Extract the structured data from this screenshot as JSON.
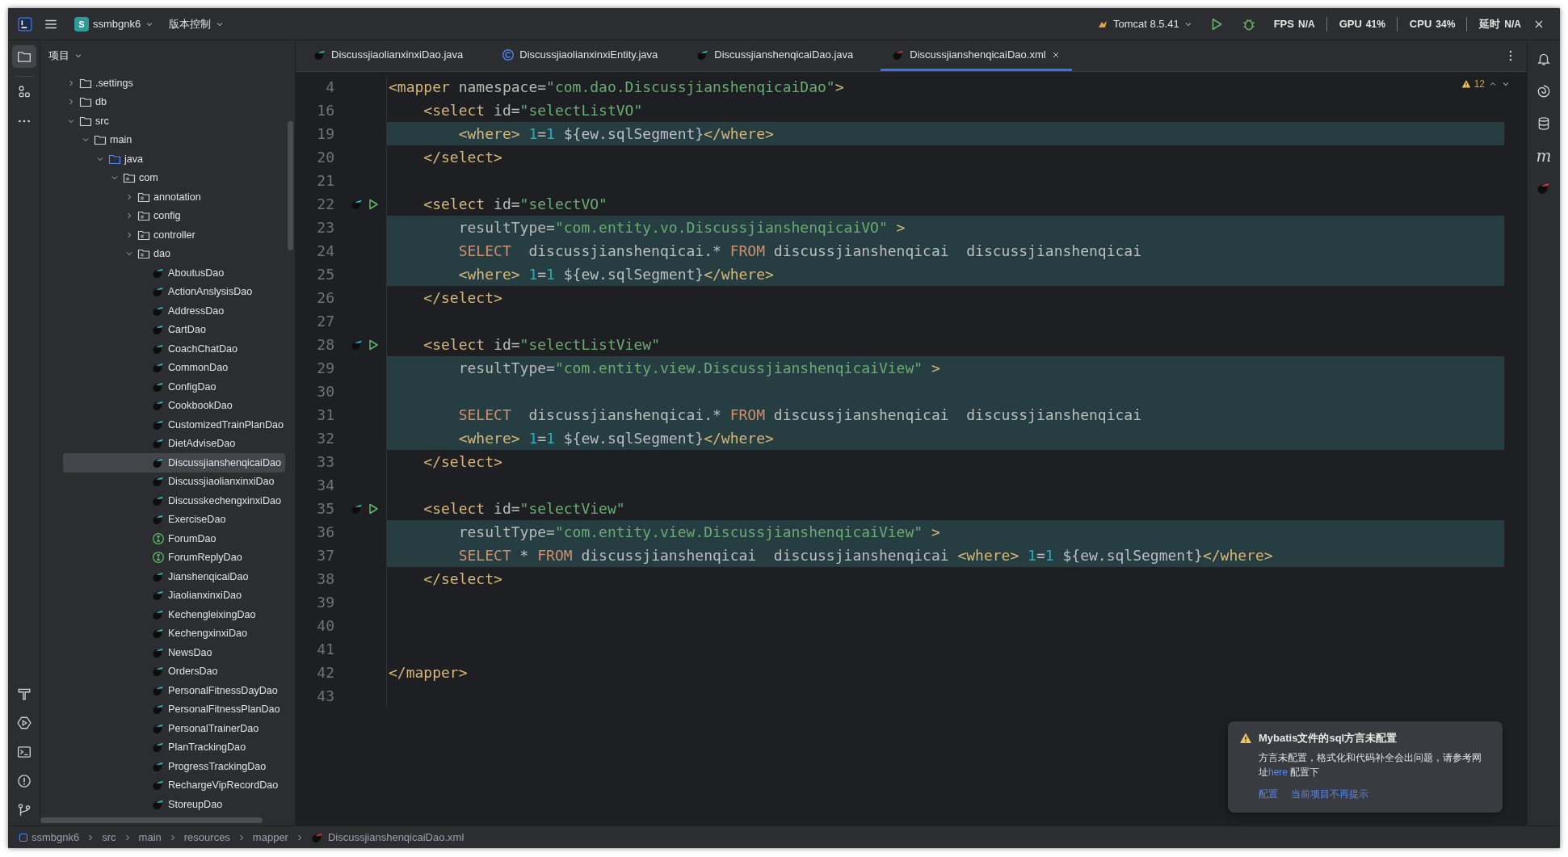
{
  "title_bar": {
    "project": {
      "badge": "S",
      "name": "ssmbgnk6"
    },
    "vcs": "版本控制",
    "run_config": "Tomcat 8.5.41",
    "metrics": [
      {
        "label": "FPS",
        "value": "N/A"
      },
      {
        "label": "GPU",
        "value": "41%"
      },
      {
        "label": "CPU",
        "value": "34%"
      },
      {
        "label": "延时",
        "value": "N/A"
      }
    ]
  },
  "right_stripe": {
    "glyph": "m"
  },
  "project_panel": {
    "title": "项目",
    "tree": [
      {
        "label": ".settings",
        "kind": "folder",
        "expanded": false,
        "selected": false
      },
      {
        "label": "db",
        "kind": "folder",
        "expanded": false,
        "selected": false
      },
      {
        "label": "src",
        "kind": "folder",
        "expanded": true,
        "selected": false,
        "children": [
          {
            "label": "main",
            "kind": "folder",
            "expanded": true,
            "selected": false,
            "children": [
              {
                "label": "java",
                "kind": "source_folder",
                "expanded": true,
                "selected": false,
                "children": [
                  {
                    "label": "com",
                    "kind": "package",
                    "expanded": true,
                    "selected": false,
                    "children": [
                      {
                        "label": "annotation",
                        "kind": "package",
                        "expanded": false,
                        "selected": false
                      },
                      {
                        "label": "config",
                        "kind": "package",
                        "expanded": false,
                        "selected": false
                      },
                      {
                        "label": "controller",
                        "kind": "package",
                        "expanded": false,
                        "selected": false
                      },
                      {
                        "label": "dao",
                        "kind": "package",
                        "expanded": true,
                        "selected": false,
                        "children": [
                          {
                            "label": "AboutusDao",
                            "kind": "mapper",
                            "selected": false
                          },
                          {
                            "label": "ActionAnslysisDao",
                            "kind": "mapper",
                            "selected": false
                          },
                          {
                            "label": "AddressDao",
                            "kind": "mapper",
                            "selected": false
                          },
                          {
                            "label": "CartDao",
                            "kind": "mapper",
                            "selected": false
                          },
                          {
                            "label": "CoachChatDao",
                            "kind": "mapper",
                            "selected": false
                          },
                          {
                            "label": "CommonDao",
                            "kind": "mapper",
                            "selected": false
                          },
                          {
                            "label": "ConfigDao",
                            "kind": "mapper",
                            "selected": false
                          },
                          {
                            "label": "CookbookDao",
                            "kind": "mapper",
                            "selected": false
                          },
                          {
                            "label": "CustomizedTrainPlanDao",
                            "kind": "mapper",
                            "selected": false
                          },
                          {
                            "label": "DietAdviseDao",
                            "kind": "mapper",
                            "selected": false
                          },
                          {
                            "label": "DiscussjianshenqicaiDao",
                            "kind": "mapper",
                            "selected": true
                          },
                          {
                            "label": "DiscussjiaolianxinxiDao",
                            "kind": "mapper",
                            "selected": false
                          },
                          {
                            "label": "DiscusskechengxinxiDao",
                            "kind": "mapper",
                            "selected": false
                          },
                          {
                            "label": "ExerciseDao",
                            "kind": "mapper",
                            "selected": false
                          },
                          {
                            "label": "ForumDao",
                            "kind": "interface",
                            "selected": false
                          },
                          {
                            "label": "ForumReplyDao",
                            "kind": "interface",
                            "selected": false
                          },
                          {
                            "label": "JianshenqicaiDao",
                            "kind": "mapper",
                            "selected": false
                          },
                          {
                            "label": "JiaolianxinxiDao",
                            "kind": "mapper",
                            "selected": false
                          },
                          {
                            "label": "KechengleixingDao",
                            "kind": "mapper",
                            "selected": false
                          },
                          {
                            "label": "KechengxinxiDao",
                            "kind": "mapper",
                            "selected": false
                          },
                          {
                            "label": "NewsDao",
                            "kind": "mapper",
                            "selected": false
                          },
                          {
                            "label": "OrdersDao",
                            "kind": "mapper",
                            "selected": false
                          },
                          {
                            "label": "PersonalFitnessDayDao",
                            "kind": "mapper",
                            "selected": false
                          },
                          {
                            "label": "PersonalFitnessPlanDao",
                            "kind": "mapper",
                            "selected": false
                          },
                          {
                            "label": "PersonalTrainerDao",
                            "kind": "mapper",
                            "selected": false
                          },
                          {
                            "label": "PlanTrackingDao",
                            "kind": "mapper",
                            "selected": false
                          },
                          {
                            "label": "ProgressTrackingDao",
                            "kind": "mapper",
                            "selected": false
                          },
                          {
                            "label": "RechargeVipRecordDao",
                            "kind": "mapper",
                            "selected": false
                          },
                          {
                            "label": "StoreupDao",
                            "kind": "mapper",
                            "selected": false
                          }
                        ]
                      }
                    ]
                  }
                ]
              }
            ]
          }
        ]
      }
    ]
  },
  "tabs": [
    {
      "label": "DiscussjiaolianxinxiDao.java",
      "kind": "mapper",
      "selected": false
    },
    {
      "label": "DiscussjiaolianxinxiEntity.java",
      "kind": "class",
      "selected": false
    },
    {
      "label": "DiscussjianshenqicaiDao.java",
      "kind": "mapper",
      "selected": false
    },
    {
      "label": "DiscussjianshenqicaiDao.xml",
      "kind": "xml",
      "selected": true
    }
  ],
  "editor": {
    "warning_count": "12",
    "lines": [
      {
        "number": "4",
        "highlighted": false,
        "marker": false,
        "tokens": [
          {
            "kind": "tag",
            "text": "<mapper"
          },
          {
            "kind": "attr",
            "text": " namespace"
          },
          {
            "kind": "plain",
            "text": "="
          },
          {
            "kind": "string",
            "text": "\"com.dao.DiscussjianshenqicaiDao\""
          },
          {
            "kind": "tag",
            "text": ">"
          }
        ]
      },
      {
        "number": "16",
        "highlighted": false,
        "marker": false,
        "tokens": [
          {
            "kind": "tag",
            "text": "    <select"
          },
          {
            "kind": "attr",
            "text": " id"
          },
          {
            "kind": "plain",
            "text": "="
          },
          {
            "kind": "string",
            "text": "\"selectListVO\""
          }
        ]
      },
      {
        "number": "19",
        "highlighted": true,
        "marker": false,
        "tokens": [
          {
            "kind": "tag",
            "text": "        <where>"
          },
          {
            "kind": "number",
            "text": " 1"
          },
          {
            "kind": "plain",
            "text": "="
          },
          {
            "kind": "number",
            "text": "1"
          },
          {
            "kind": "plain",
            "text": " ${ew.sqlSegment}"
          },
          {
            "kind": "tag",
            "text": "</where>"
          }
        ]
      },
      {
        "number": "20",
        "highlighted": false,
        "marker": false,
        "tokens": [
          {
            "kind": "tag",
            "text": "    </select>"
          }
        ]
      },
      {
        "number": "21",
        "highlighted": false,
        "marker": false
      },
      {
        "number": "22",
        "highlighted": false,
        "marker": true,
        "tokens": [
          {
            "kind": "tag",
            "text": "    <select"
          },
          {
            "kind": "attr",
            "text": " id"
          },
          {
            "kind": "plain",
            "text": "="
          },
          {
            "kind": "string",
            "text": "\"selectVO\""
          }
        ]
      },
      {
        "number": "23",
        "highlighted": true,
        "marker": false,
        "tokens": [
          {
            "kind": "attr",
            "text": "        resultType"
          },
          {
            "kind": "plain",
            "text": "="
          },
          {
            "kind": "string",
            "text": "\"com.entity.vo.DiscussjianshenqicaiVO\""
          },
          {
            "kind": "tag",
            "text": " >"
          }
        ]
      },
      {
        "number": "24",
        "highlighted": true,
        "marker": false,
        "tokens": [
          {
            "kind": "keyword",
            "text": "        SELECT"
          },
          {
            "kind": "plain",
            "text": "  discussjianshenqicai.* "
          },
          {
            "kind": "keyword",
            "text": "FROM"
          },
          {
            "kind": "plain",
            "text": " discussjianshenqicai  discussjianshenqicai"
          }
        ]
      },
      {
        "number": "25",
        "highlighted": true,
        "marker": false,
        "tokens": [
          {
            "kind": "tag",
            "text": "        <where>"
          },
          {
            "kind": "number",
            "text": " 1"
          },
          {
            "kind": "plain",
            "text": "="
          },
          {
            "kind": "number",
            "text": "1"
          },
          {
            "kind": "plain",
            "text": " ${ew.sqlSegment}"
          },
          {
            "kind": "tag",
            "text": "</where>"
          }
        ]
      },
      {
        "number": "26",
        "highlighted": false,
        "marker": false,
        "tokens": [
          {
            "kind": "tag",
            "text": "    </select>"
          }
        ]
      },
      {
        "number": "27",
        "highlighted": false,
        "marker": false
      },
      {
        "number": "28",
        "highlighted": false,
        "marker": true,
        "tokens": [
          {
            "kind": "tag",
            "text": "    <select"
          },
          {
            "kind": "attr",
            "text": " id"
          },
          {
            "kind": "plain",
            "text": "="
          },
          {
            "kind": "string",
            "text": "\"selectListView\""
          }
        ]
      },
      {
        "number": "29",
        "highlighted": true,
        "marker": false,
        "tokens": [
          {
            "kind": "attr",
            "text": "        resultType"
          },
          {
            "kind": "plain",
            "text": "="
          },
          {
            "kind": "string",
            "text": "\"com.entity.view.DiscussjianshenqicaiView\""
          },
          {
            "kind": "tag",
            "text": " >"
          }
        ]
      },
      {
        "number": "30",
        "highlighted": true,
        "marker": false
      },
      {
        "number": "31",
        "highlighted": true,
        "marker": false,
        "tokens": [
          {
            "kind": "keyword",
            "text": "        SELECT"
          },
          {
            "kind": "plain",
            "text": "  discussjianshenqicai.* "
          },
          {
            "kind": "keyword",
            "text": "FROM"
          },
          {
            "kind": "plain",
            "text": " discussjianshenqicai  discussjianshenqicai"
          }
        ]
      },
      {
        "number": "32",
        "highlighted": true,
        "marker": false,
        "tokens": [
          {
            "kind": "tag",
            "text": "        <where>"
          },
          {
            "kind": "number",
            "text": " 1"
          },
          {
            "kind": "plain",
            "text": "="
          },
          {
            "kind": "number",
            "text": "1"
          },
          {
            "kind": "plain",
            "text": " ${ew.sqlSegment}"
          },
          {
            "kind": "tag",
            "text": "</where>"
          }
        ]
      },
      {
        "number": "33",
        "highlighted": false,
        "marker": false,
        "tokens": [
          {
            "kind": "tag",
            "text": "    </select>"
          }
        ]
      },
      {
        "number": "34",
        "highlighted": false,
        "marker": false
      },
      {
        "number": "35",
        "highlighted": false,
        "marker": true,
        "tokens": [
          {
            "kind": "tag",
            "text": "    <select"
          },
          {
            "kind": "attr",
            "text": " id"
          },
          {
            "kind": "plain",
            "text": "="
          },
          {
            "kind": "string",
            "text": "\"selectView\""
          }
        ]
      },
      {
        "number": "36",
        "highlighted": true,
        "marker": false,
        "tokens": [
          {
            "kind": "attr",
            "text": "        resultType"
          },
          {
            "kind": "plain",
            "text": "="
          },
          {
            "kind": "string",
            "text": "\"com.entity.view.DiscussjianshenqicaiView\""
          },
          {
            "kind": "tag",
            "text": " >"
          }
        ]
      },
      {
        "number": "37",
        "highlighted": true,
        "marker": false,
        "tokens": [
          {
            "kind": "keyword",
            "text": "        SELECT"
          },
          {
            "kind": "plain",
            "text": " * "
          },
          {
            "kind": "keyword",
            "text": "FROM"
          },
          {
            "kind": "plain",
            "text": " discussjianshenqicai  discussjianshenqicai "
          },
          {
            "kind": "tag",
            "text": "<where>"
          },
          {
            "kind": "number",
            "text": " 1"
          },
          {
            "kind": "plain",
            "text": "="
          },
          {
            "kind": "number",
            "text": "1"
          },
          {
            "kind": "plain",
            "text": " ${ew.sqlSegment}"
          },
          {
            "kind": "tag",
            "text": "</where>"
          }
        ]
      },
      {
        "number": "38",
        "highlighted": false,
        "marker": false,
        "tokens": [
          {
            "kind": "tag",
            "text": "    </select>"
          }
        ]
      },
      {
        "number": "39",
        "highlighted": false,
        "marker": false
      },
      {
        "number": "40",
        "highlighted": false,
        "marker": false
      },
      {
        "number": "41",
        "highlighted": false,
        "marker": false
      },
      {
        "number": "42",
        "highlighted": false,
        "marker": false,
        "tokens": [
          {
            "kind": "tag",
            "text": "</mapper>"
          }
        ]
      },
      {
        "number": "43",
        "highlighted": false,
        "marker": false
      }
    ]
  },
  "notification": {
    "title": "Mybatis文件的sql方言未配置",
    "body": [
      {
        "kind": "text",
        "text": "方言未配置，格式化和代码补全会出问题，请参考网址"
      },
      {
        "kind": "link",
        "text": "here"
      },
      {
        "kind": "text",
        "text": " 配置下"
      }
    ],
    "actions": [
      "配置",
      "当前项目不再提示"
    ]
  },
  "breadcrumb": [
    "ssmbgnk6",
    "src",
    "main",
    "resources",
    "mapper",
    "DiscussjianshenqicaiDao.xml"
  ]
}
